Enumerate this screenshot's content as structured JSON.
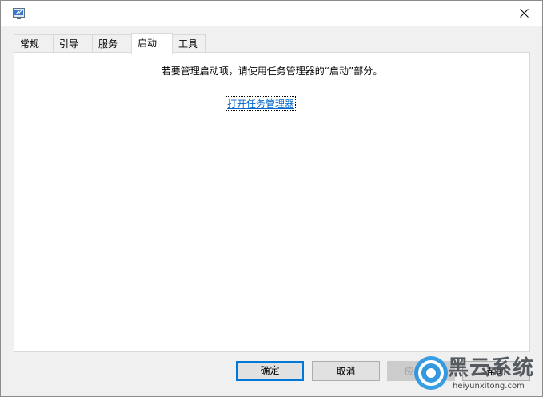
{
  "window": {
    "app_icon": "msconfig-icon",
    "close_glyph": "✕"
  },
  "tabs": [
    {
      "label": "常规"
    },
    {
      "label": "引导"
    },
    {
      "label": "服务"
    },
    {
      "label": "启动"
    },
    {
      "label": "工具"
    }
  ],
  "active_tab": "启动",
  "startup": {
    "message": "若要管理启动项，请使用任务管理器的“启动”部分。",
    "link": "打开任务管理器"
  },
  "buttons": {
    "ok": "确定",
    "cancel": "取消",
    "apply": "应用(A)",
    "help": "帮助"
  },
  "watermark": {
    "brand": "黑云系统",
    "url": "heiyunxitong.com"
  },
  "colors": {
    "link": "#0066cc",
    "default_button_border": "#0078d7",
    "logo_blue": "#1a8fe3"
  }
}
